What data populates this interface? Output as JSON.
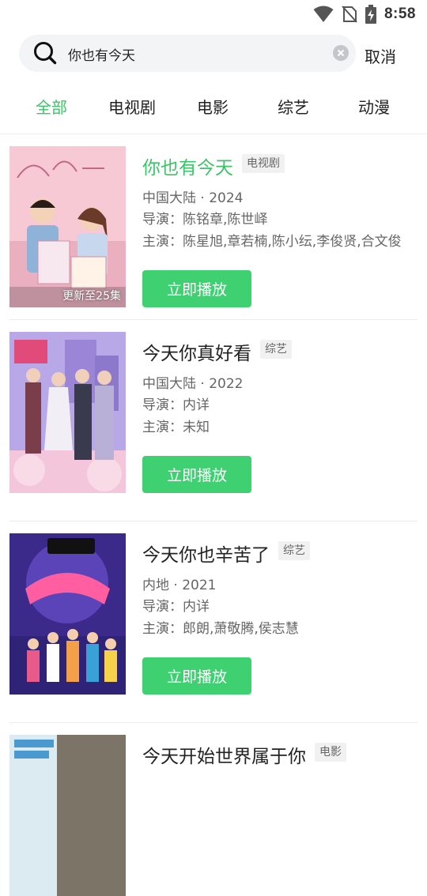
{
  "status_bar": {
    "time": "8:58"
  },
  "search": {
    "query": "你也有今天",
    "cancel_label": "取消"
  },
  "tabs": [
    {
      "label": "全部",
      "active": true
    },
    {
      "label": "电视剧",
      "active": false
    },
    {
      "label": "电影",
      "active": false
    },
    {
      "label": "综艺",
      "active": false
    },
    {
      "label": "动漫",
      "active": false
    }
  ],
  "results": [
    {
      "title": "你也有今天",
      "type": "电视剧",
      "meta": "中国大陆 · 2024",
      "director": "导演：陈铭章,陈世峄",
      "cast": "主演：陈星旭,章若楠,陈小纭,李俊贤,合文俊",
      "badge": "更新至25集",
      "play_label": "立即播放"
    },
    {
      "title": "今天你真好看",
      "type": "综艺",
      "meta": "中国大陆 · 2022",
      "director": "导演：内详",
      "cast": "主演：未知",
      "play_label": "立即播放"
    },
    {
      "title": "今天你也辛苦了",
      "type": "综艺",
      "meta": "内地 · 2021",
      "director": "导演：内详",
      "cast": "主演：郎朗,萧敬腾,侯志慧",
      "play_label": "立即播放"
    },
    {
      "title": "今天开始世界属于你",
      "type": "电影"
    }
  ],
  "colors": {
    "accent": "#3dc368",
    "button": "#3fd171"
  }
}
